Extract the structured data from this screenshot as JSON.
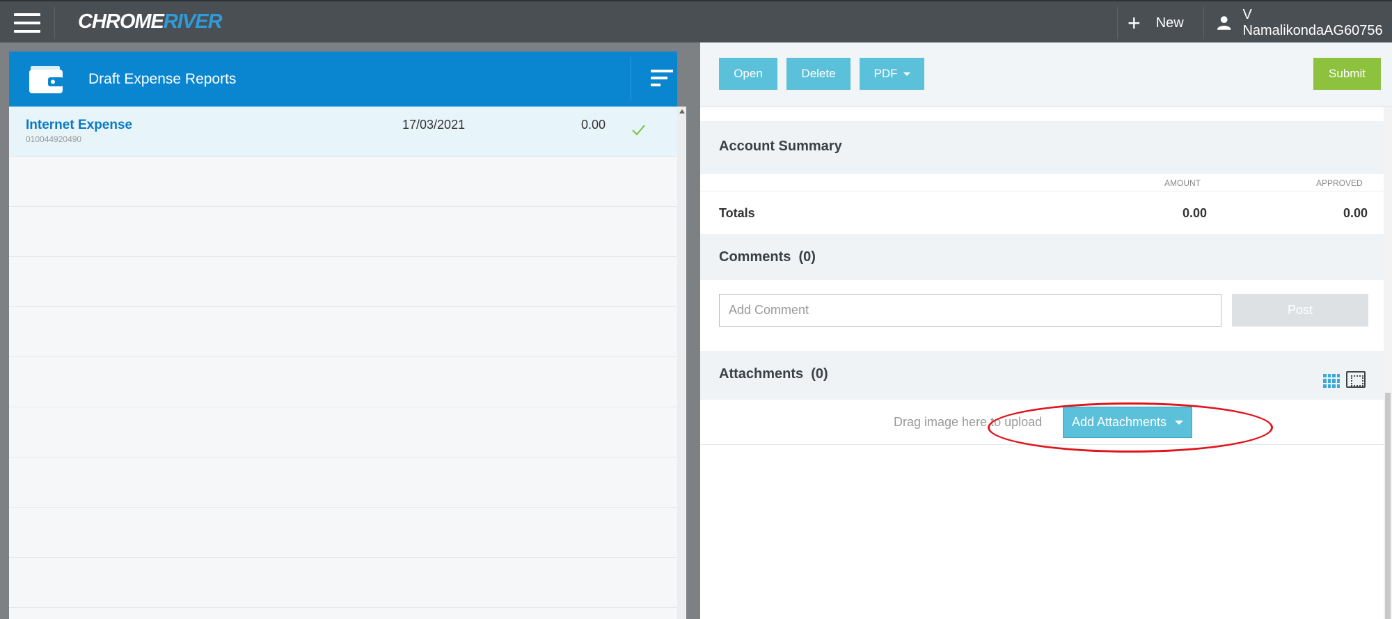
{
  "topbar": {
    "logo_white": "CHROME",
    "logo_blue": "RIVER",
    "new_label": "New",
    "user_name": "V NamalikondaAG60756"
  },
  "left_panel": {
    "title": "Draft Expense Reports",
    "reports": [
      {
        "name": "Internet Expense",
        "number": "010044920490",
        "date": "17/03/2021",
        "amount": "0.00",
        "status": "check-icon"
      }
    ]
  },
  "toolbar": {
    "open_label": "Open",
    "delete_label": "Delete",
    "pdf_label": "PDF",
    "submit_label": "Submit"
  },
  "account_summary": {
    "title": "Account Summary",
    "col_amount": "AMOUNT",
    "col_approved": "APPROVED",
    "totals_label": "Totals",
    "totals_amount": "0.00",
    "totals_approved": "0.00"
  },
  "comments": {
    "title": "Comments",
    "count": "(0)",
    "placeholder": "Add Comment",
    "post_label": "Post"
  },
  "attachments": {
    "title": "Attachments",
    "count": "(0)",
    "drag_text": "Drag image here to upload",
    "add_label": "Add Attachments"
  },
  "colors": {
    "topbar": "#4a4f54",
    "header_blue": "#0a85cf",
    "button_teal": "#5bc0d9",
    "submit_green": "#8cc23e",
    "highlight_red": "#e0141c"
  }
}
